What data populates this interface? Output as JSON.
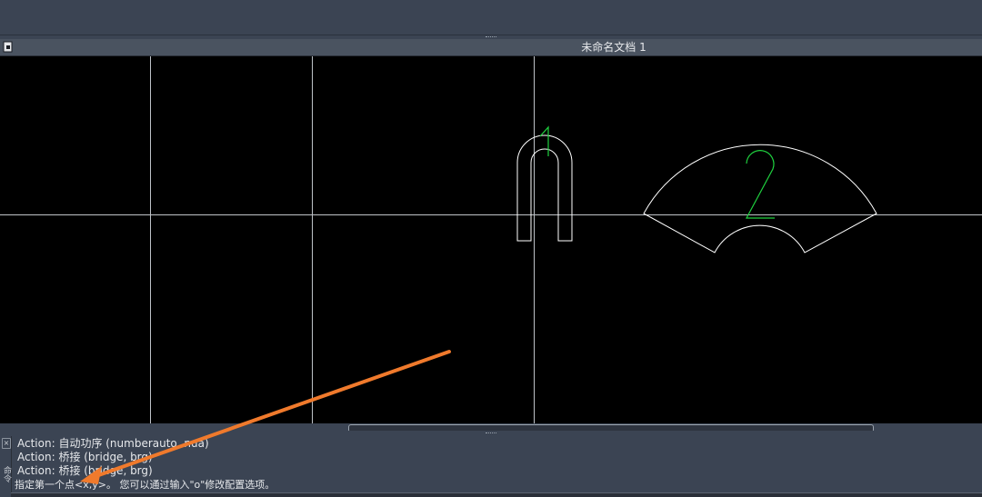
{
  "document": {
    "title": "未命名文档 1"
  },
  "canvas": {
    "shape_labels": [
      "1",
      "2"
    ]
  },
  "command_history": [
    "Action: 自动功序 (numberauto, nua)",
    "Action: 桥接 (bridge, brg)",
    "Action: 桥接 (bridge, brg)"
  ],
  "command_prompt": "指定第一个点<x,y>。 您可以通过输入\"o\"修改配置选项。",
  "command_side_label": "命令",
  "colors": {
    "ui_background": "#3b4453",
    "canvas_background": "#000000",
    "geometry": "#ffffff",
    "label_green": "#1fd13f",
    "annotation_arrow": "#f07a2c"
  },
  "icons": [
    "document-icon",
    "close-icon",
    "arrow-annotation"
  ]
}
